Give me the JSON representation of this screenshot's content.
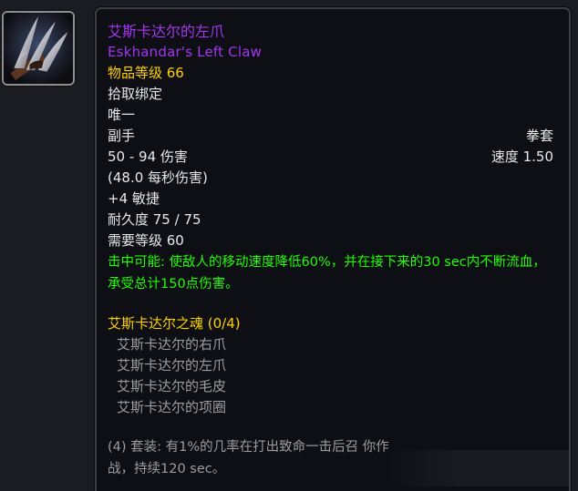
{
  "item": {
    "icon": "claw-weapon-icon",
    "name_cn": "艾斯卡达尔的左爪",
    "name_en": "Eskhandar's Left Claw",
    "item_level": "物品等级 66",
    "binding": "拾取绑定",
    "unique": "唯一",
    "slot": "副手",
    "weapon_type": "拳套",
    "damage": "50 - 94 伤害",
    "speed": "速度 1.50",
    "dps": "(48.0 每秒伤害)",
    "stat": "+4 敏捷",
    "durability": "耐久度 75 / 75",
    "required_level": "需要等级 60",
    "proc_text": "击中可能: 使敌人的移动速度降低60%，并在接下来的30 sec内不断流血，承受总计150点伤害。"
  },
  "item_set": {
    "title": "艾斯卡达尔之魂 (0/4)",
    "pieces": [
      "艾斯卡达尔的右爪",
      "艾斯卡达尔的左爪",
      "艾斯卡达尔的毛皮",
      "艾斯卡达尔的项圈"
    ],
    "bonus": "(4) 套装: 有1%的几率在打出致命一击后召 你作战，持续120 sec。"
  },
  "colors": {
    "epic": "#a335ee",
    "gold": "#ffd100",
    "uncommon_green": "#1eff00",
    "inactive_grey": "#9d9d9d"
  }
}
